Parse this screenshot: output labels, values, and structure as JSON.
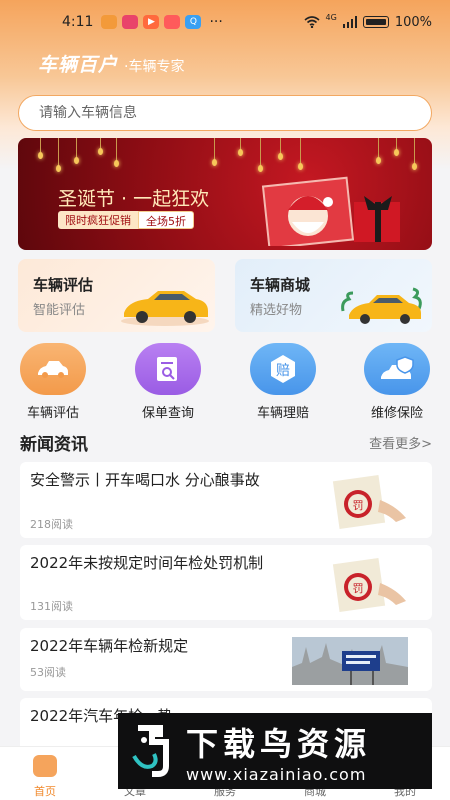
{
  "status_bar": {
    "time": "4:11",
    "network": "4G",
    "battery": "100%"
  },
  "header": {
    "brand": "车辆百户",
    "slogan": "·车辆专家"
  },
  "search": {
    "placeholder": "请输入车辆信息"
  },
  "banner": {
    "title": "圣诞节 · 一起狂欢",
    "tag_promo": "限时疯狂促销",
    "tag_discount": "全场5折"
  },
  "feature_cards": [
    {
      "title": "车辆评估",
      "subtitle": "智能评估"
    },
    {
      "title": "车辆商城",
      "subtitle": "精选好物"
    }
  ],
  "quick_links": [
    {
      "label": "车辆评估",
      "icon": "car-icon",
      "color": "#f5a45c"
    },
    {
      "label": "保单查询",
      "icon": "document-search-icon",
      "color": "#a76de8"
    },
    {
      "label": "车辆理赔",
      "icon": "claim-badge-icon",
      "color": "#5aa7f2"
    },
    {
      "label": "维修保险",
      "icon": "car-shield-icon",
      "color": "#5aa7f2"
    }
  ],
  "news": {
    "section_title": "新闻资讯",
    "more_label": "查看更多>",
    "items": [
      {
        "title": "安全警示丨开车喝口水 分心酿事故",
        "reads": "218阅读"
      },
      {
        "title": "2022年未按规定时间年检处罚机制",
        "reads": "131阅读"
      },
      {
        "title": "2022年车辆年检新规定",
        "reads": "53阅读"
      },
      {
        "title": "2022年汽车年检...势",
        "reads": ""
      }
    ]
  },
  "tabbar": [
    {
      "label": "首页",
      "active": true
    },
    {
      "label": "文章",
      "active": false
    },
    {
      "label": "服务",
      "active": false
    },
    {
      "label": "商城",
      "active": false
    },
    {
      "label": "我的",
      "active": false
    }
  ],
  "watermark": {
    "text": "下载鸟资源",
    "url": "www.xiazainiao.com"
  },
  "colors": {
    "accent": "#f5a45c",
    "banner_red": "#b5131b"
  }
}
